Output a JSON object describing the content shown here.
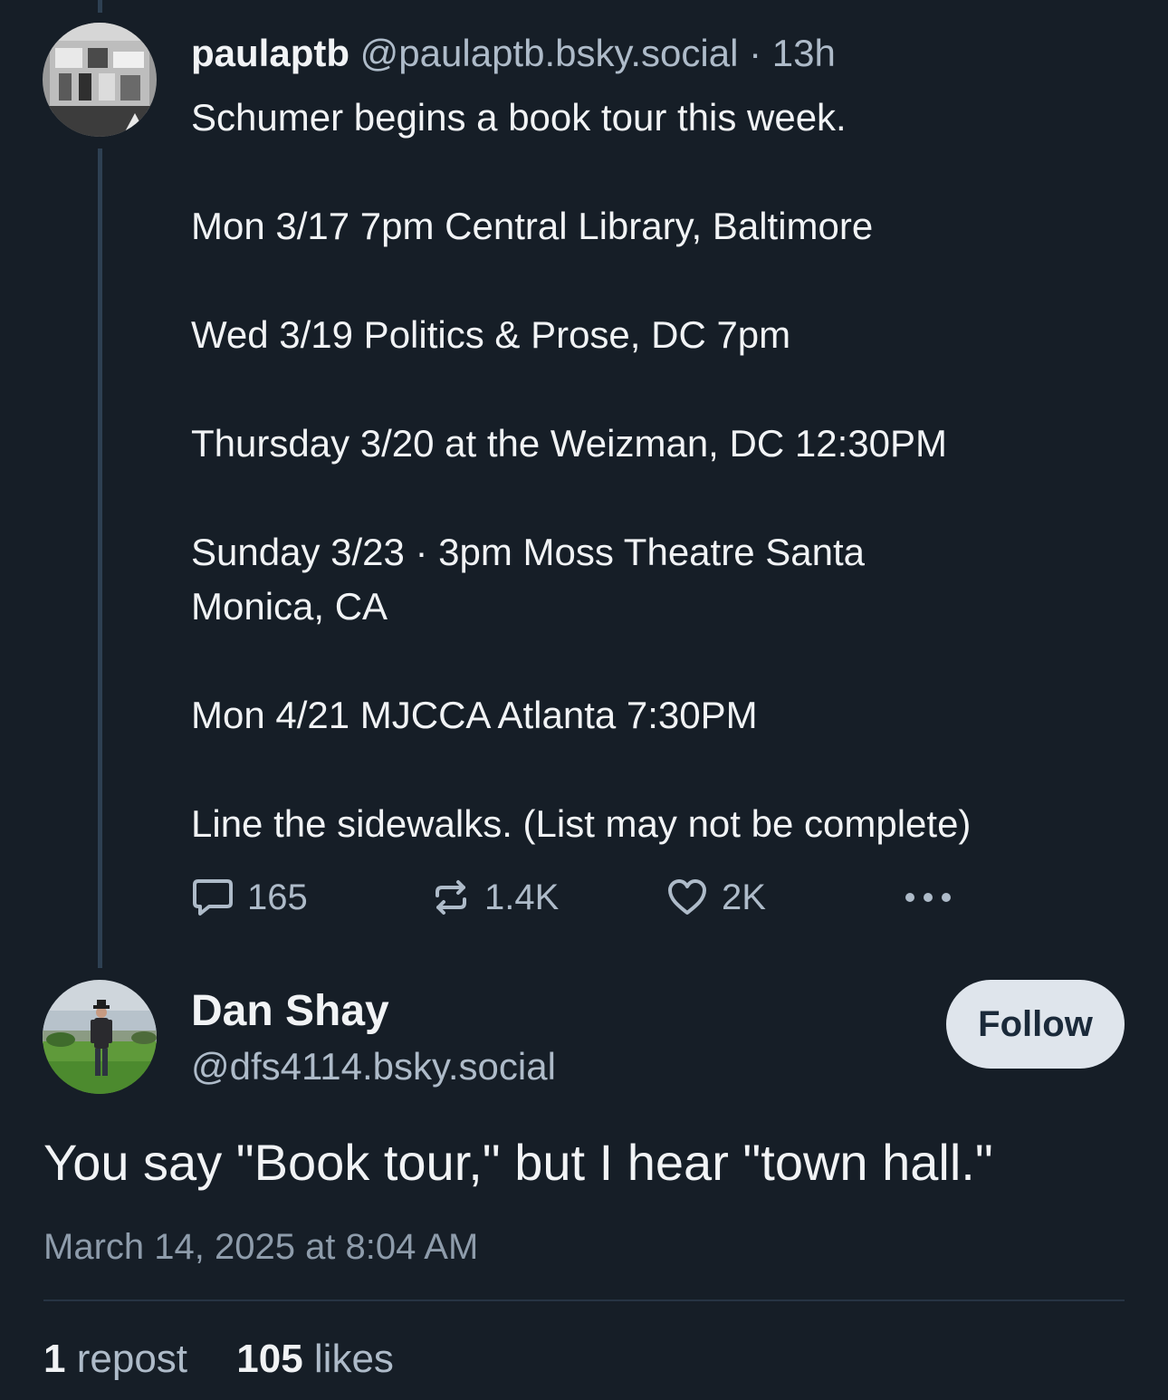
{
  "parent_post": {
    "author_name": "paulaptb",
    "author_handle": "@paulaptb.bsky.social",
    "separator": "·",
    "time_ago": "13h",
    "text_lines": [
      "Schumer begins a book tour this week.",
      "Mon 3/17 7pm Central Library, Baltimore",
      "Wed 3/19 Politics & Prose, DC 7pm",
      "Thursday 3/20 at the Weizman, DC 12:30PM",
      "Sunday 3/23 · 3pm  Moss Theatre Santa",
      "Monica, CA",
      "Mon 4/21 MJCCA Atlanta 7:30PM",
      "Line the sidewalks. (List may not be complete)"
    ],
    "actions": {
      "reply_count": "165",
      "repost_count": "1.4K",
      "like_count": "2K"
    }
  },
  "reply_post": {
    "author_name": "Dan Shay",
    "author_handle": "@dfs4114.bsky.social",
    "follow_label": "Follow",
    "text": "You say \"Book tour,\" but I hear \"town hall.\"",
    "timestamp": "March 14, 2025 at 8:04 AM",
    "stats": {
      "repost_count": "1",
      "repost_label": "repost",
      "like_count": "105",
      "like_label": "likes"
    }
  },
  "icons": {
    "reply": "speech-bubble-icon",
    "repost": "repost-arrows-icon",
    "like": "heart-icon",
    "more": "ellipsis-icon"
  },
  "colors": {
    "background": "#161e27",
    "text_primary": "#f1f3f5",
    "text_secondary": "#aebbc9",
    "thread_line": "#2e4052",
    "follow_button_bg": "#dfe5ec"
  }
}
